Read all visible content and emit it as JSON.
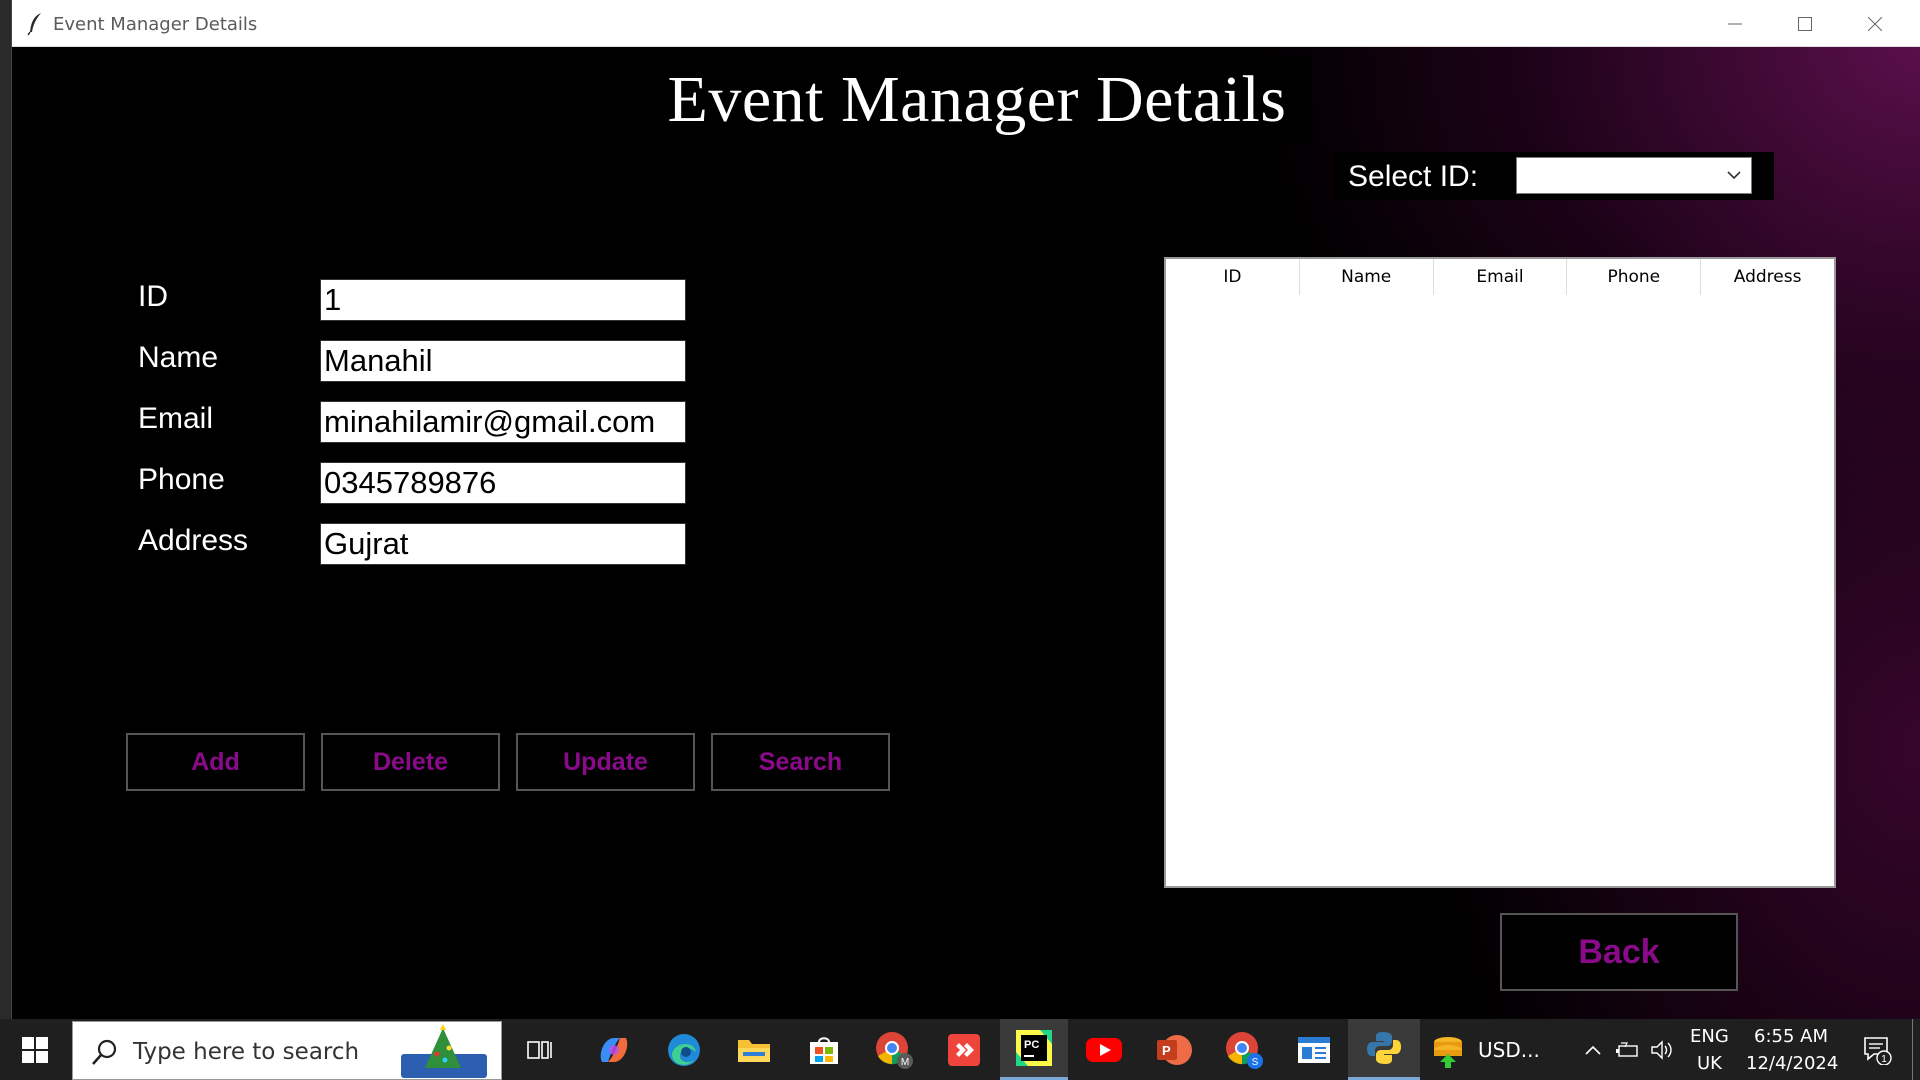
{
  "window": {
    "title": "Event Manager Details",
    "heading": "Event Manager Details"
  },
  "select": {
    "label": "Select ID:",
    "value": ""
  },
  "form": {
    "fields": [
      {
        "label": "ID",
        "value": "1"
      },
      {
        "label": "Name",
        "value": "Manahil"
      },
      {
        "label": "Email",
        "value": "minahilamir@gmail.com"
      },
      {
        "label": "Phone",
        "value": "0345789876"
      },
      {
        "label": "Address",
        "value": "Gujrat"
      }
    ],
    "buttons": {
      "add": "Add",
      "delete": "Delete",
      "update": "Update",
      "search": "Search"
    },
    "back": "Back",
    "accent_color": "#8a0a8a"
  },
  "table": {
    "columns": [
      "ID",
      "Name",
      "Email",
      "Phone",
      "Address"
    ],
    "rows": []
  },
  "taskbar": {
    "search_placeholder": "Type here to search",
    "apps": [
      "task-view",
      "copilot",
      "edge",
      "file-explorer",
      "microsoft-store",
      "chrome",
      "anydesk",
      "pycharm",
      "youtube",
      "powerpoint",
      "chrome-profile",
      "notepad",
      "python"
    ],
    "weather": "USD...",
    "language": "ENG",
    "region": "UK",
    "time": "6:55 AM",
    "date": "12/4/2024",
    "notifications": "1"
  }
}
